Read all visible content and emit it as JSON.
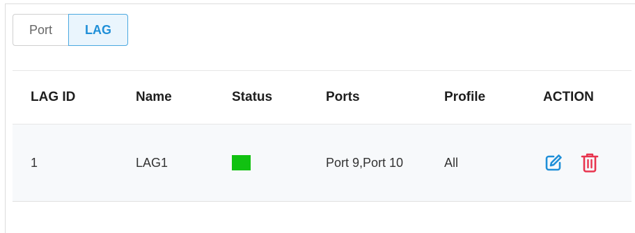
{
  "tabs": {
    "port_label": "Port",
    "lag_label": "LAG",
    "active": "LAG"
  },
  "table": {
    "headers": {
      "lag_id": "LAG ID",
      "name": "Name",
      "status": "Status",
      "ports": "Ports",
      "profile": "Profile",
      "action": "ACTION"
    },
    "rows": [
      {
        "lag_id": "1",
        "name": "LAG1",
        "status_color": "#11C111",
        "ports": "Port 9,Port 10",
        "profile": "All",
        "actions": [
          "edit-icon",
          "delete-icon"
        ]
      }
    ]
  },
  "colors": {
    "accent": "#1F8FD8",
    "delete": "#E8344E",
    "status_up": "#11C111"
  }
}
